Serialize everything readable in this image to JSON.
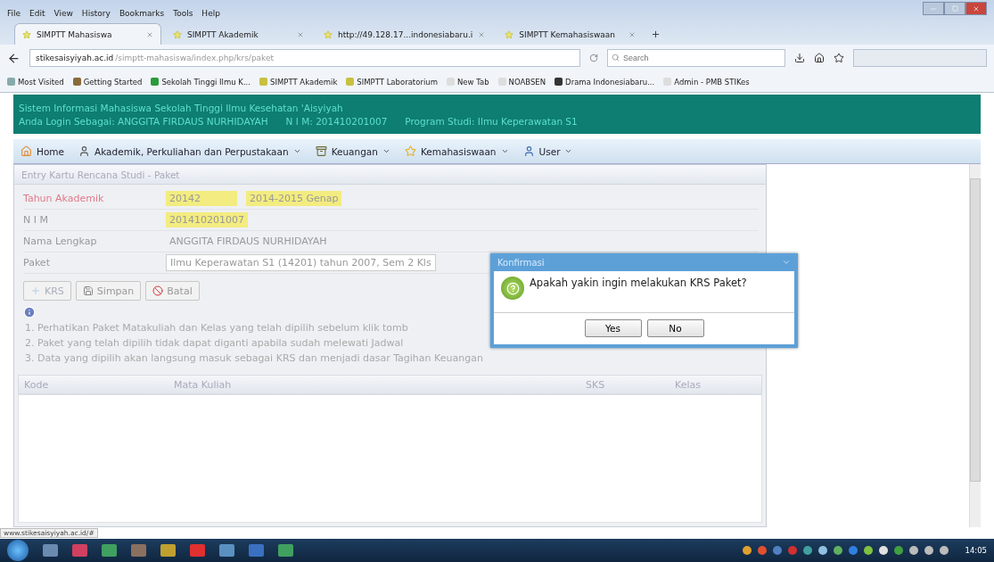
{
  "menu_bar": [
    "File",
    "Edit",
    "View",
    "History",
    "Bookmarks",
    "Tools",
    "Help"
  ],
  "browser_tabs": [
    {
      "title": "SIMPTT Mahasiswa",
      "selected": true
    },
    {
      "title": "SIMPTT Akademik",
      "selected": false
    },
    {
      "title": "http://49.128.17...indonesiabaru.i",
      "selected": false
    },
    {
      "title": "SIMPTT Kemahasiswaan",
      "selected": false
    }
  ],
  "address_bar": {
    "domain": "stikesaisyiyah.ac.id",
    "path": "/simptt-mahasiswa/index.php/krs/paket"
  },
  "search_box": {
    "placeholder": "Search"
  },
  "bookmarks": [
    "Most Visited",
    "Getting Started",
    "Sekolah Tinggi Ilmu K...",
    "SIMPTT Akademik",
    "SIMPTT Laboratorium",
    "New Tab",
    "NOABSEN",
    "Drama Indonesiabaru...",
    "Admin - PMB STIKes"
  ],
  "header": {
    "title": "Sistem Informasi Mahasiswa Sekolah Tinggi Ilmu Kesehatan 'Aisyiyah",
    "login_line": "Anda Login Sebagai: ANGGITA FIRDAUS NURHIDAYAH      N I M: 201410201007      Program Studi: Ilmu Keperawatan S1"
  },
  "nav": [
    {
      "label": "Home",
      "dropdown": false
    },
    {
      "label": "Akademik, Perkuliahan dan Perpustakaan",
      "dropdown": true
    },
    {
      "label": "Keuangan",
      "dropdown": true
    },
    {
      "label": "Kemahasiswaan",
      "dropdown": true
    },
    {
      "label": "User",
      "dropdown": true
    }
  ],
  "panel": {
    "title": "Entry Kartu Rencana Studi - Paket",
    "fields": [
      {
        "label": "Tahun Akademik",
        "required": true,
        "kind": "highlight",
        "values": [
          "20142",
          "2014-2015 Genap"
        ]
      },
      {
        "label": "N I M",
        "required": false,
        "kind": "highlight",
        "values": [
          "201410201007"
        ]
      },
      {
        "label": "Nama Lengkap",
        "required": false,
        "kind": "plain",
        "values": [
          "ANGGITA FIRDAUS NURHIDAYAH"
        ]
      },
      {
        "label": "Paket",
        "required": false,
        "kind": "select",
        "values": [
          "Ilmu Keperawatan S1 (14201) tahun 2007, Sem 2 Kls"
        ]
      }
    ],
    "buttons": [
      {
        "label": "KRS",
        "disabled": true,
        "kind": "add"
      },
      {
        "label": "Simpan",
        "disabled": false,
        "kind": "save"
      },
      {
        "label": "Batal",
        "disabled": false,
        "kind": "cancel"
      }
    ],
    "notes": [
      "1. Perhatikan Paket Matakuliah dan Kelas yang telah dipilih sebelum klik tomb",
      "2. Paket yang telah dipilih tidak dapat diganti apabila sudah melewati Jadwal",
      "3. Data yang dipilih akan langsung masuk sebagai KRS dan menjadi dasar Tagihan Keuangan"
    ],
    "table": {
      "columns": [
        "Kode",
        "Mata Kuliah",
        "SKS",
        "Kelas"
      ]
    }
  },
  "dialog": {
    "title": "Konfirmasi",
    "message": "Apakah yakin ingin melakukan KRS Paket?",
    "buttons": [
      "Yes",
      "No"
    ]
  },
  "status_link": "www.stikesaisyiyah.ac.id/#",
  "taskbar": {
    "clock": "14:05"
  }
}
